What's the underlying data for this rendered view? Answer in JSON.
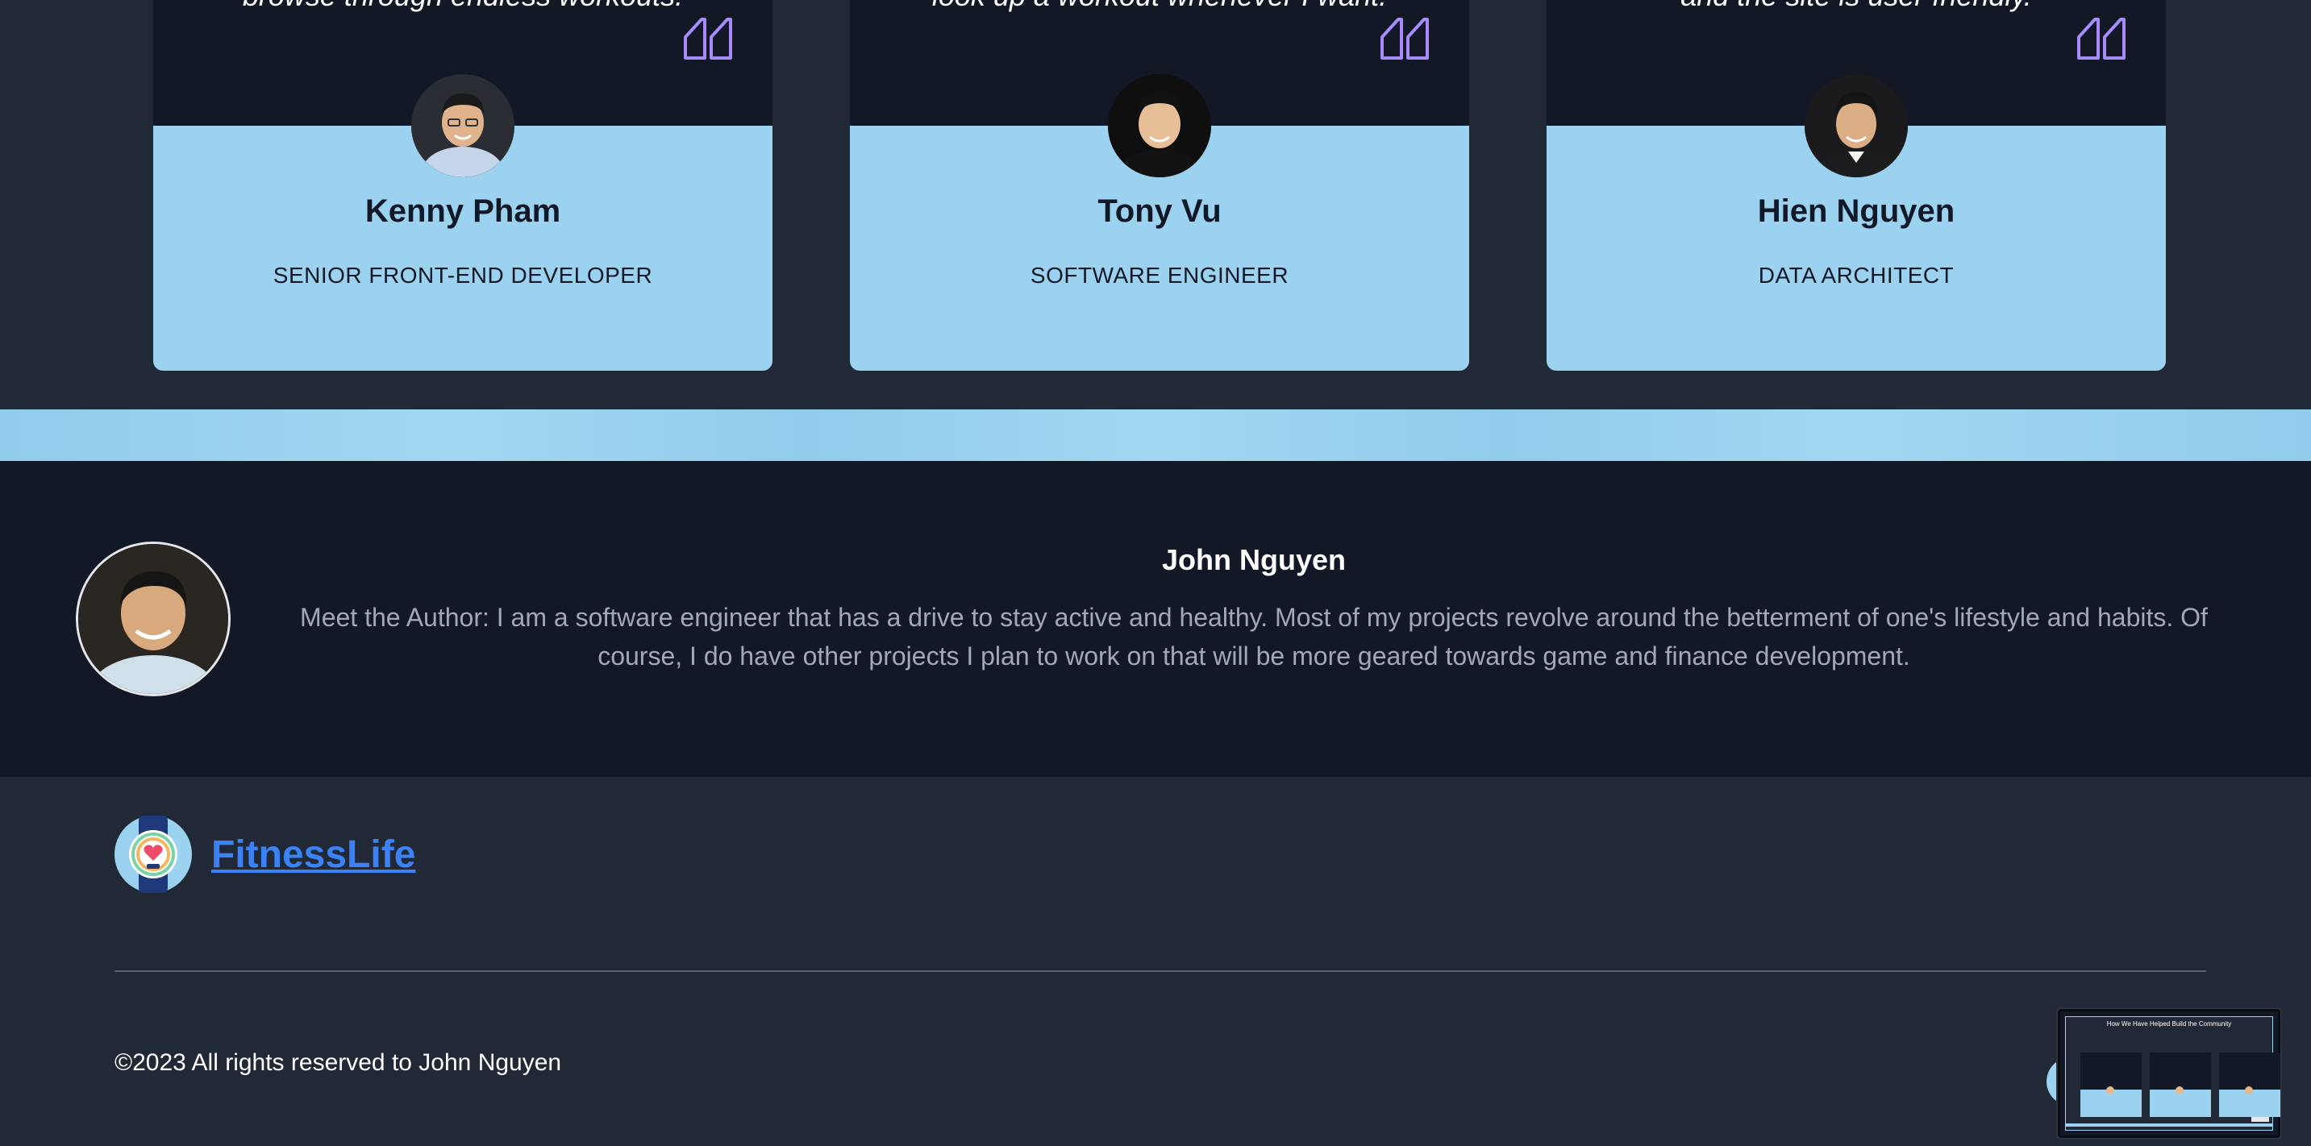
{
  "testimonials": [
    {
      "quote_fragment": "browse through endless workouts.",
      "name": "Kenny Pham",
      "role": "SENIOR FRONT-END DEVELOPER"
    },
    {
      "quote_fragment": "look up a workout whenever I want.",
      "name": "Tony Vu",
      "role": "SOFTWARE ENGINEER"
    },
    {
      "quote_fragment": "and the site is user friendly.",
      "name": "Hien Nguyen",
      "role": "DATA ARCHITECT"
    }
  ],
  "author": {
    "name": "John Nguyen",
    "bio": "Meet the Author: I am a software engineer that has a drive to stay active and healthy. Most of my projects revolve around the betterment of one's lifestyle and habits. Of course, I do have other projects I plan to work on that will be more geared towards game and finance development."
  },
  "footer": {
    "brand_name": "FitnessLife",
    "copyright": "©2023 All rights reserved to John Nguyen"
  },
  "preview": {
    "title": "How We Have Helped Build the Community"
  },
  "colors": {
    "page_bg": "#222936",
    "dark_bg": "#121826",
    "card_light": "#9ad2ef",
    "accent_purple": "#a78bfa",
    "link_blue": "#3b82f6"
  },
  "icons": {
    "quote": "quote-icon",
    "logo": "fitness-heart-logo"
  }
}
